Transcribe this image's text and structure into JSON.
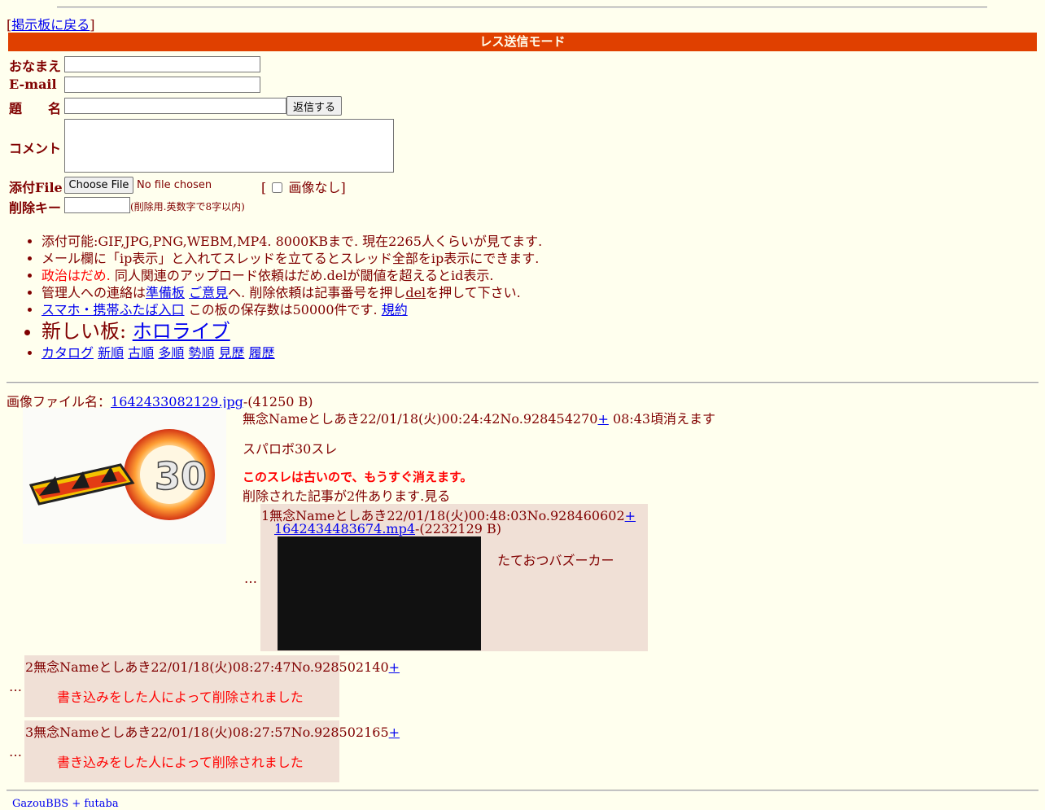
{
  "nav": {
    "back_bracket_open": "[",
    "back_link": "掲示板に戻る",
    "back_bracket_close": "]"
  },
  "form": {
    "mode_title": "レス送信モード",
    "name_label": "おなまえ",
    "email_label": "E-mail",
    "subject_label": "題　　名",
    "submit_label": "返信する",
    "comment_label": "コメント",
    "file_label": "添付File",
    "choose_file_label": "Choose File",
    "no_file_text": "No file chosen",
    "no_image_prefix": "[",
    "no_image_label": "画像なし",
    "no_image_suffix": "]",
    "delkey_label": "削除キー",
    "delkey_note": "(削除用.英数字で8字以内)"
  },
  "rules": {
    "r1": "添付可能:GIF,JPG,PNG,WEBM,MP4. 8000KBまで. 現在2265人くらいが見てます.",
    "r2": "メール欄に「ip表示」と入れてスレッドを立てるとスレッド全部をip表示にできます.",
    "r3_red": "政治はだめ.",
    "r3_rest": " 同人関連のアップロード依頼はだめ.delが閾値を超えるとid表示.",
    "r4_pre": "管理人への連絡は",
    "r4_link1": "準備板",
    "r4_link2": "ご意見",
    "r4_mid": "へ. 削除依頼は記事番号を押し",
    "r4_del": "del",
    "r4_post": "を押して下さい.",
    "r5_link": "スマホ・携帯ふたば入口",
    "r5_mid": " この板の保存数は50000件です. ",
    "r5_link2": "規約",
    "r6_pre": "新しい板: ",
    "r6_link": "ホロライブ",
    "links": [
      "カタログ",
      "新順",
      "古順",
      "多順",
      "勢順",
      "見歴",
      "履歴"
    ]
  },
  "thread": {
    "file_label": "画像ファイル名：",
    "file_name": "1642433082129.jpg",
    "file_size": "-(41250 B)",
    "header": "無念Nameとしあき22/01/18(火)00:24:42No.928454270",
    "plus": "+",
    "expire": " 08:43頃消えます",
    "body": "スパロボ30スレ",
    "old_warning": "このスレは古いので、もうすぐ消えます。",
    "deleted_notice": "削除された記事が2件あります.見る",
    "thumb_alt": "スーパーロボット大戦30"
  },
  "replies": [
    {
      "marker": "…",
      "header": "1無念Nameとしあき22/01/18(火)00:48:03No.928460602",
      "plus": "+",
      "file_name": "1642434483674.mp4",
      "file_size": "-(2232129 B)",
      "body": "たておつバズーカー"
    },
    {
      "marker": "…",
      "header": "2無念Nameとしあき22/01/18(火)08:27:47No.928502140",
      "plus": "+",
      "body": "書き込みをした人によって削除されました"
    },
    {
      "marker": "…",
      "header": "3無念Nameとしあき22/01/18(火)08:27:57No.928502165",
      "plus": "+",
      "body": "書き込みをした人によって削除されました"
    }
  ],
  "footer": {
    "credit": "GazouBBS + futaba"
  },
  "colors": {
    "background": "#ffffee",
    "text": "#800000",
    "bar": "#e04000",
    "reply_bg": "#f0e0d6",
    "link": "#0000ee"
  }
}
